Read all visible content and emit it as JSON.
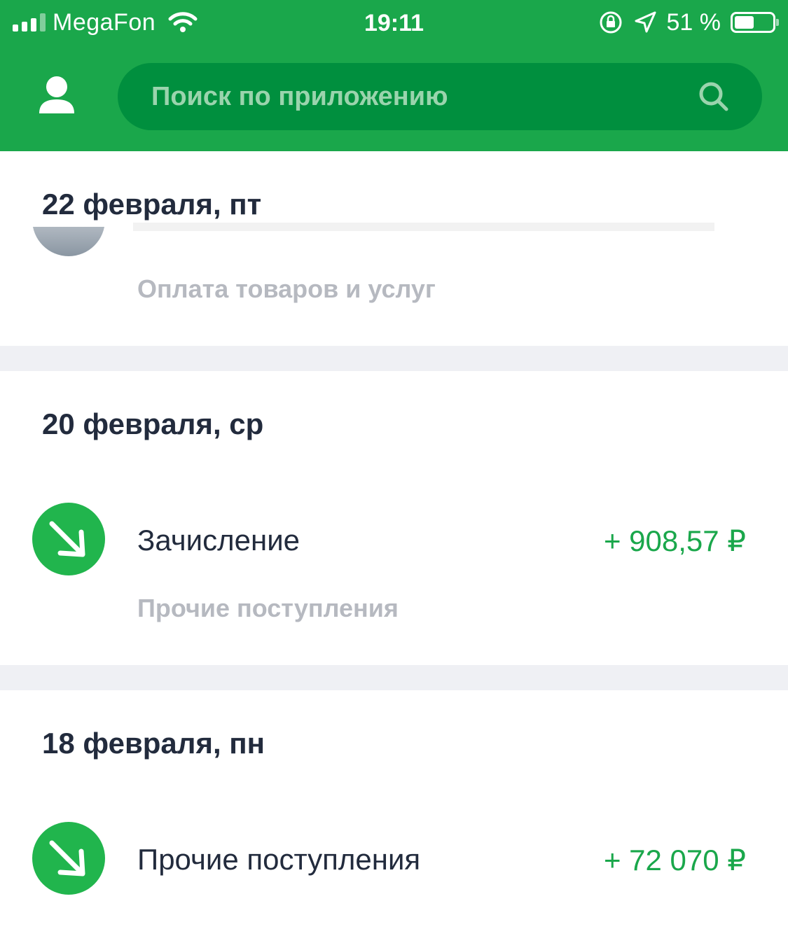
{
  "status_bar": {
    "carrier": "MegaFon",
    "time": "19:11",
    "battery_percent": "51 %",
    "battery_level": 0.51
  },
  "search": {
    "placeholder": "Поиск по приложению"
  },
  "sections": [
    {
      "date": "22 февраля, пт",
      "operations": [
        {
          "subtitle": "Оплата товаров и услуг"
        }
      ]
    },
    {
      "date": "20 февраля, ср",
      "operations": [
        {
          "title": "Зачисление",
          "amount": "+ 908,57 ₽",
          "subtitle": "Прочие поступления"
        }
      ]
    },
    {
      "date": "18 февраля, пн",
      "operations": [
        {
          "title": "Прочие поступления",
          "amount": "+ 72 070 ₽"
        }
      ]
    }
  ],
  "colors": {
    "brand_green": "#1aa74b",
    "search_bg": "#008f3e",
    "income_icon": "#21b54d",
    "separator": "#eff0f4"
  },
  "icons": [
    "signal-icon",
    "wifi-icon",
    "orientation-lock-icon",
    "location-arrow-icon",
    "battery-icon",
    "profile-icon",
    "search-icon",
    "incoming-arrow-icon"
  ]
}
